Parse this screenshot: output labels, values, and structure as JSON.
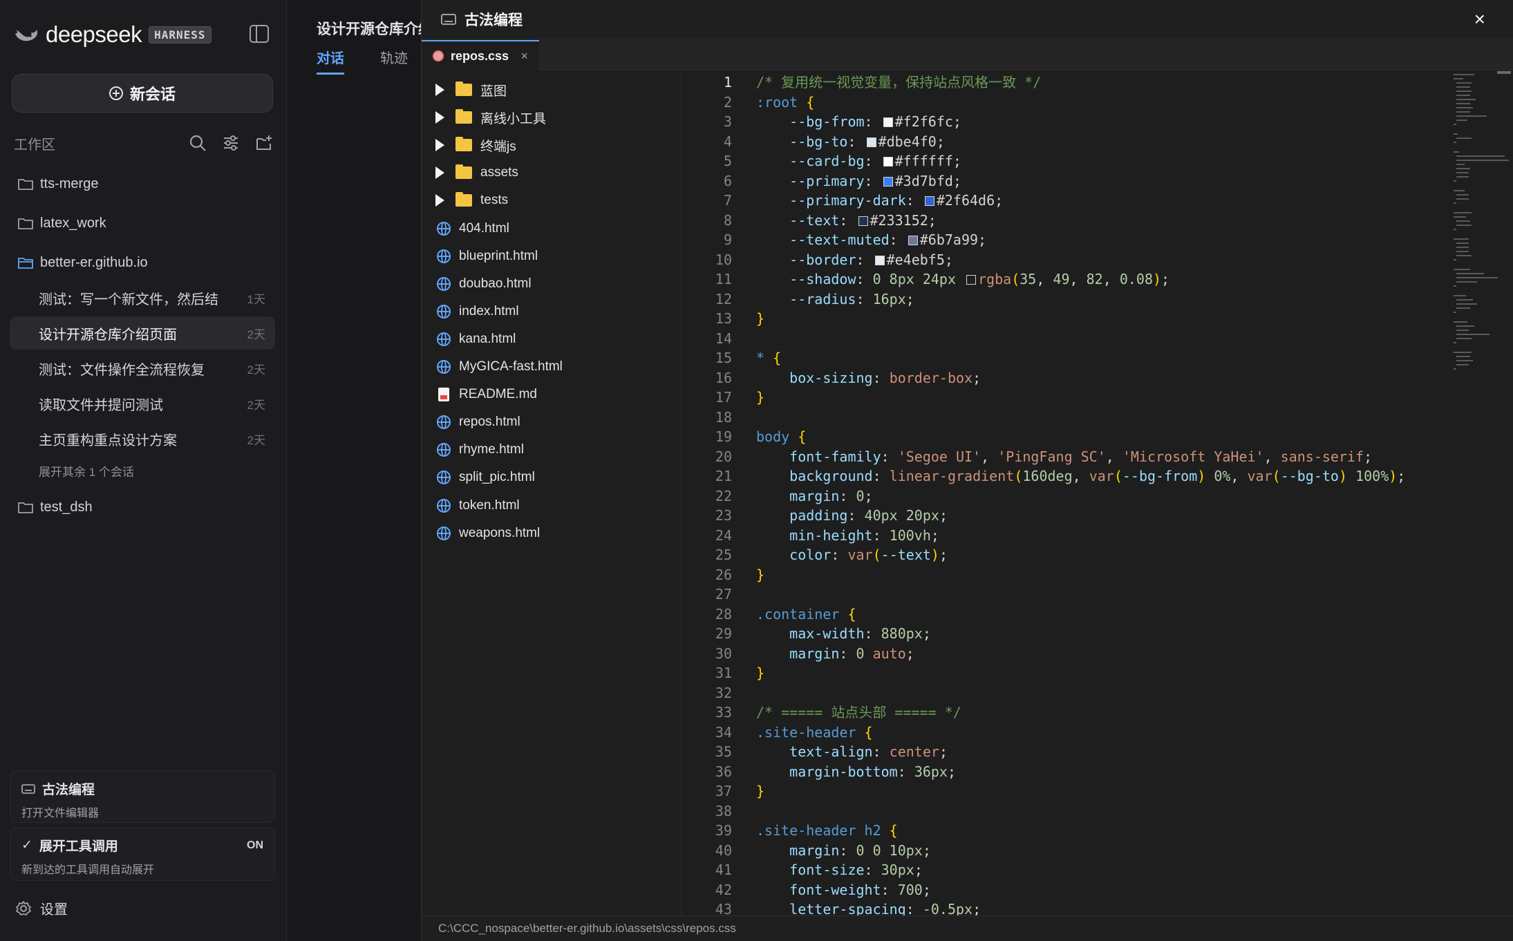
{
  "sidebar": {
    "brand": "deepseek",
    "badge": "HARNESS",
    "new_chat": "新会话",
    "workspace_title": "工作区",
    "folders": [
      {
        "name": "tts-merge"
      },
      {
        "name": "latex_work"
      },
      {
        "name": "better-er.github.io"
      },
      {
        "name": "test_dsh"
      }
    ],
    "sessions": [
      {
        "title": "测试：写一个新文件，然后结",
        "time": "1天"
      },
      {
        "title": "设计开源仓库介绍页面",
        "time": "2天"
      },
      {
        "title": "测试：文件操作全流程恢复",
        "time": "2天"
      },
      {
        "title": "读取文件并提问测试",
        "time": "2天"
      },
      {
        "title": "主页重构重点设计方案",
        "time": "2天"
      }
    ],
    "more_sessions": "展开其余 1 个会话",
    "card_editor": {
      "title": "古法编程",
      "subtitle": "打开文件编辑器"
    },
    "card_tools": {
      "title": "展开工具调用",
      "subtitle": "新到达的工具调用自动展开",
      "state": "ON"
    },
    "settings": "设置"
  },
  "convo": {
    "title": "设计开源仓库介绍页面",
    "tabs": [
      "对话",
      "轨迹"
    ]
  },
  "editor": {
    "title": "古法编程",
    "close": "×",
    "tab": {
      "name": "repos.css",
      "close": "×"
    },
    "tree": [
      {
        "name": "蓝图",
        "type": "folder"
      },
      {
        "name": "离线小工具",
        "type": "folder"
      },
      {
        "name": "终端js",
        "type": "folder"
      },
      {
        "name": "assets",
        "type": "folder"
      },
      {
        "name": "tests",
        "type": "folder"
      },
      {
        "name": "404.html",
        "type": "html"
      },
      {
        "name": "blueprint.html",
        "type": "html"
      },
      {
        "name": "doubao.html",
        "type": "html"
      },
      {
        "name": "index.html",
        "type": "html"
      },
      {
        "name": "kana.html",
        "type": "html"
      },
      {
        "name": "MyGICA-fast.html",
        "type": "html"
      },
      {
        "name": "README.md",
        "type": "md"
      },
      {
        "name": "repos.html",
        "type": "html"
      },
      {
        "name": "rhyme.html",
        "type": "html"
      },
      {
        "name": "split_pic.html",
        "type": "html"
      },
      {
        "name": "token.html",
        "type": "html"
      },
      {
        "name": "weapons.html",
        "type": "html"
      }
    ],
    "code_lines": [
      [
        {
          "c": "com",
          "t": "/* 复用统一视觉变量，保持站点风格一致 */"
        }
      ],
      [
        {
          "c": "cls",
          "t": ":root"
        },
        {
          "c": "pun",
          "t": " "
        },
        {
          "c": "brace",
          "t": "{"
        }
      ],
      [
        {
          "c": "pun",
          "t": "    "
        },
        {
          "c": "prop",
          "t": "--bg-from"
        },
        {
          "c": "pun",
          "t": ": "
        },
        {
          "c": "sw",
          "t": "#f2f6fc"
        },
        {
          "c": "pun",
          "t": "#f2f6fc;"
        }
      ],
      [
        {
          "c": "pun",
          "t": "    "
        },
        {
          "c": "prop",
          "t": "--bg-to"
        },
        {
          "c": "pun",
          "t": ": "
        },
        {
          "c": "sw",
          "t": "#dbe4f0"
        },
        {
          "c": "pun",
          "t": "#dbe4f0;"
        }
      ],
      [
        {
          "c": "pun",
          "t": "    "
        },
        {
          "c": "prop",
          "t": "--card-bg"
        },
        {
          "c": "pun",
          "t": ": "
        },
        {
          "c": "sw",
          "t": "#ffffff"
        },
        {
          "c": "pun",
          "t": "#ffffff;"
        }
      ],
      [
        {
          "c": "pun",
          "t": "    "
        },
        {
          "c": "prop",
          "t": "--primary"
        },
        {
          "c": "pun",
          "t": ": "
        },
        {
          "c": "sw",
          "t": "#3d7bfd"
        },
        {
          "c": "pun",
          "t": "#3d7bfd;"
        }
      ],
      [
        {
          "c": "pun",
          "t": "    "
        },
        {
          "c": "prop",
          "t": "--primary-dark"
        },
        {
          "c": "pun",
          "t": ": "
        },
        {
          "c": "sw",
          "t": "#2f64d6"
        },
        {
          "c": "pun",
          "t": "#2f64d6;"
        }
      ],
      [
        {
          "c": "pun",
          "t": "    "
        },
        {
          "c": "prop",
          "t": "--text"
        },
        {
          "c": "pun",
          "t": ": "
        },
        {
          "c": "sw",
          "t": "#233152"
        },
        {
          "c": "pun",
          "t": "#233152;"
        }
      ],
      [
        {
          "c": "pun",
          "t": "    "
        },
        {
          "c": "prop",
          "t": "--text-muted"
        },
        {
          "c": "pun",
          "t": ": "
        },
        {
          "c": "sw",
          "t": "#6b7a99"
        },
        {
          "c": "pun",
          "t": "#6b7a99;"
        }
      ],
      [
        {
          "c": "pun",
          "t": "    "
        },
        {
          "c": "prop",
          "t": "--border"
        },
        {
          "c": "pun",
          "t": ": "
        },
        {
          "c": "sw",
          "t": "#e4ebf5"
        },
        {
          "c": "pun",
          "t": "#e4ebf5;"
        }
      ],
      [
        {
          "c": "pun",
          "t": "    "
        },
        {
          "c": "prop",
          "t": "--shadow"
        },
        {
          "c": "pun",
          "t": ": "
        },
        {
          "c": "num",
          "t": "0 8px 24px "
        },
        {
          "c": "sw",
          "t": "rgba(35, 49, 82, 0.08)"
        },
        {
          "c": "val",
          "t": "rgba"
        },
        {
          "c": "brace",
          "t": "("
        },
        {
          "c": "num",
          "t": "35"
        },
        {
          "c": "pun",
          "t": ", "
        },
        {
          "c": "num",
          "t": "49"
        },
        {
          "c": "pun",
          "t": ", "
        },
        {
          "c": "num",
          "t": "82"
        },
        {
          "c": "pun",
          "t": ", "
        },
        {
          "c": "num",
          "t": "0.08"
        },
        {
          "c": "brace",
          "t": ")"
        },
        {
          "c": "pun",
          "t": ";"
        }
      ],
      [
        {
          "c": "pun",
          "t": "    "
        },
        {
          "c": "prop",
          "t": "--radius"
        },
        {
          "c": "pun",
          "t": ": "
        },
        {
          "c": "num",
          "t": "16px"
        },
        {
          "c": "pun",
          "t": ";"
        }
      ],
      [
        {
          "c": "brace",
          "t": "}"
        }
      ],
      [],
      [
        {
          "c": "cls",
          "t": "*"
        },
        {
          "c": "pun",
          "t": " "
        },
        {
          "c": "brace",
          "t": "{"
        }
      ],
      [
        {
          "c": "pun",
          "t": "    "
        },
        {
          "c": "prop",
          "t": "box-sizing"
        },
        {
          "c": "pun",
          "t": ": "
        },
        {
          "c": "val",
          "t": "border-box"
        },
        {
          "c": "pun",
          "t": ";"
        }
      ],
      [
        {
          "c": "brace",
          "t": "}"
        }
      ],
      [],
      [
        {
          "c": "cls",
          "t": "body"
        },
        {
          "c": "pun",
          "t": " "
        },
        {
          "c": "brace",
          "t": "{"
        }
      ],
      [
        {
          "c": "pun",
          "t": "    "
        },
        {
          "c": "prop",
          "t": "font-family"
        },
        {
          "c": "pun",
          "t": ": "
        },
        {
          "c": "str",
          "t": "'Segoe UI'"
        },
        {
          "c": "pun",
          "t": ", "
        },
        {
          "c": "str",
          "t": "'PingFang SC'"
        },
        {
          "c": "pun",
          "t": ", "
        },
        {
          "c": "str",
          "t": "'Microsoft YaHei'"
        },
        {
          "c": "pun",
          "t": ", "
        },
        {
          "c": "val",
          "t": "sans-serif"
        },
        {
          "c": "pun",
          "t": ";"
        }
      ],
      [
        {
          "c": "pun",
          "t": "    "
        },
        {
          "c": "prop",
          "t": "background"
        },
        {
          "c": "pun",
          "t": ": "
        },
        {
          "c": "val",
          "t": "linear-gradient"
        },
        {
          "c": "brace",
          "t": "("
        },
        {
          "c": "num",
          "t": "160deg"
        },
        {
          "c": "pun",
          "t": ", "
        },
        {
          "c": "val",
          "t": "var"
        },
        {
          "c": "brace",
          "t": "("
        },
        {
          "c": "var",
          "t": "--bg-from"
        },
        {
          "c": "brace",
          "t": ")"
        },
        {
          "c": "num",
          "t": " 0%"
        },
        {
          "c": "pun",
          "t": ", "
        },
        {
          "c": "val",
          "t": "var"
        },
        {
          "c": "brace",
          "t": "("
        },
        {
          "c": "var",
          "t": "--bg-to"
        },
        {
          "c": "brace",
          "t": ")"
        },
        {
          "c": "num",
          "t": " 100%"
        },
        {
          "c": "brace",
          "t": ")"
        },
        {
          "c": "pun",
          "t": ";"
        }
      ],
      [
        {
          "c": "pun",
          "t": "    "
        },
        {
          "c": "prop",
          "t": "margin"
        },
        {
          "c": "pun",
          "t": ": "
        },
        {
          "c": "num",
          "t": "0"
        },
        {
          "c": "pun",
          "t": ";"
        }
      ],
      [
        {
          "c": "pun",
          "t": "    "
        },
        {
          "c": "prop",
          "t": "padding"
        },
        {
          "c": "pun",
          "t": ": "
        },
        {
          "c": "num",
          "t": "40px 20px"
        },
        {
          "c": "pun",
          "t": ";"
        }
      ],
      [
        {
          "c": "pun",
          "t": "    "
        },
        {
          "c": "prop",
          "t": "min-height"
        },
        {
          "c": "pun",
          "t": ": "
        },
        {
          "c": "num",
          "t": "100vh"
        },
        {
          "c": "pun",
          "t": ";"
        }
      ],
      [
        {
          "c": "pun",
          "t": "    "
        },
        {
          "c": "prop",
          "t": "color"
        },
        {
          "c": "pun",
          "t": ": "
        },
        {
          "c": "val",
          "t": "var"
        },
        {
          "c": "brace",
          "t": "("
        },
        {
          "c": "var",
          "t": "--text"
        },
        {
          "c": "brace",
          "t": ")"
        },
        {
          "c": "pun",
          "t": ";"
        }
      ],
      [
        {
          "c": "brace",
          "t": "}"
        }
      ],
      [],
      [
        {
          "c": "cls",
          "t": ".container"
        },
        {
          "c": "pun",
          "t": " "
        },
        {
          "c": "brace",
          "t": "{"
        }
      ],
      [
        {
          "c": "pun",
          "t": "    "
        },
        {
          "c": "prop",
          "t": "max-width"
        },
        {
          "c": "pun",
          "t": ": "
        },
        {
          "c": "num",
          "t": "880px"
        },
        {
          "c": "pun",
          "t": ";"
        }
      ],
      [
        {
          "c": "pun",
          "t": "    "
        },
        {
          "c": "prop",
          "t": "margin"
        },
        {
          "c": "pun",
          "t": ": "
        },
        {
          "c": "num",
          "t": "0 "
        },
        {
          "c": "val",
          "t": "auto"
        },
        {
          "c": "pun",
          "t": ";"
        }
      ],
      [
        {
          "c": "brace",
          "t": "}"
        }
      ],
      [],
      [
        {
          "c": "com",
          "t": "/* ===== 站点头部 ===== */"
        }
      ],
      [
        {
          "c": "cls",
          "t": ".site-header"
        },
        {
          "c": "pun",
          "t": " "
        },
        {
          "c": "brace",
          "t": "{"
        }
      ],
      [
        {
          "c": "pun",
          "t": "    "
        },
        {
          "c": "prop",
          "t": "text-align"
        },
        {
          "c": "pun",
          "t": ": "
        },
        {
          "c": "val",
          "t": "center"
        },
        {
          "c": "pun",
          "t": ";"
        }
      ],
      [
        {
          "c": "pun",
          "t": "    "
        },
        {
          "c": "prop",
          "t": "margin-bottom"
        },
        {
          "c": "pun",
          "t": ": "
        },
        {
          "c": "num",
          "t": "36px"
        },
        {
          "c": "pun",
          "t": ";"
        }
      ],
      [
        {
          "c": "brace",
          "t": "}"
        }
      ],
      [],
      [
        {
          "c": "cls",
          "t": ".site-header h2"
        },
        {
          "c": "pun",
          "t": " "
        },
        {
          "c": "brace",
          "t": "{"
        }
      ],
      [
        {
          "c": "pun",
          "t": "    "
        },
        {
          "c": "prop",
          "t": "margin"
        },
        {
          "c": "pun",
          "t": ": "
        },
        {
          "c": "num",
          "t": "0 0 10px"
        },
        {
          "c": "pun",
          "t": ";"
        }
      ],
      [
        {
          "c": "pun",
          "t": "    "
        },
        {
          "c": "prop",
          "t": "font-size"
        },
        {
          "c": "pun",
          "t": ": "
        },
        {
          "c": "num",
          "t": "30px"
        },
        {
          "c": "pun",
          "t": ";"
        }
      ],
      [
        {
          "c": "pun",
          "t": "    "
        },
        {
          "c": "prop",
          "t": "font-weight"
        },
        {
          "c": "pun",
          "t": ": "
        },
        {
          "c": "num",
          "t": "700"
        },
        {
          "c": "pun",
          "t": ";"
        }
      ],
      [
        {
          "c": "pun",
          "t": "    "
        },
        {
          "c": "prop",
          "t": "letter-spacing"
        },
        {
          "c": "pun",
          "t": ": "
        },
        {
          "c": "num",
          "t": "-0.5px"
        },
        {
          "c": "pun",
          "t": ";"
        }
      ]
    ],
    "file_path": "C:\\CCC_nospace\\better-er.github.io\\assets\\css\\repos.css"
  }
}
